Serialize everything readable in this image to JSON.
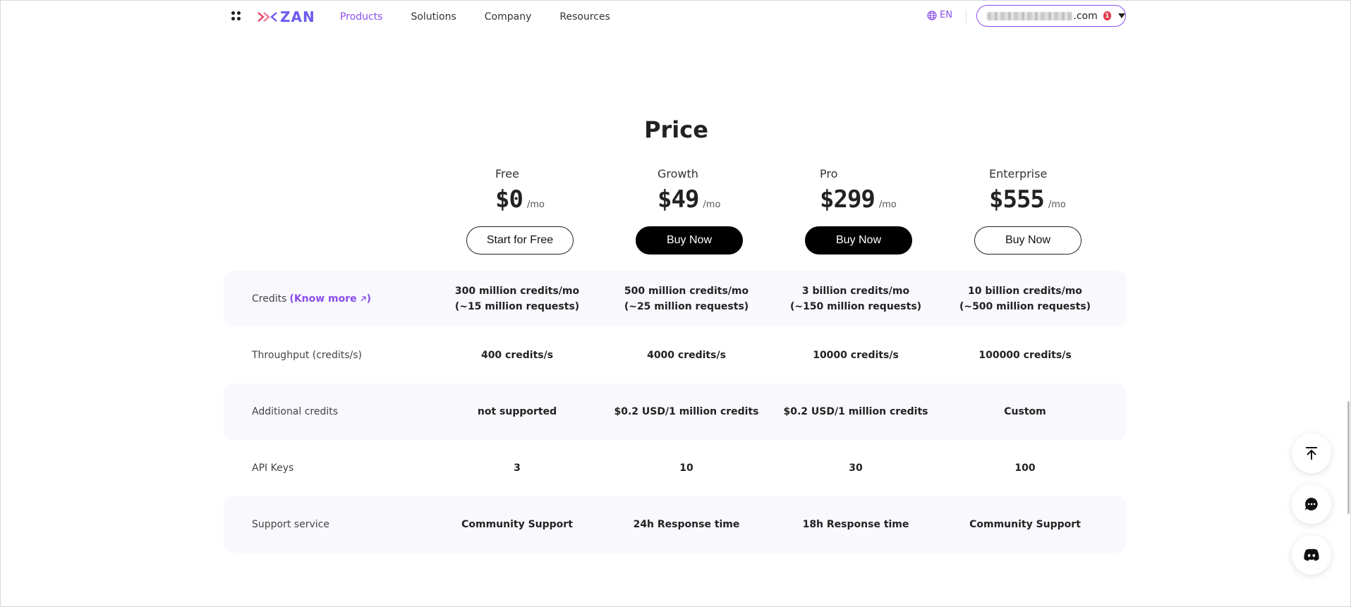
{
  "header": {
    "logo_text": "ZAN",
    "nav": [
      "Products",
      "Solutions",
      "Company",
      "Resources"
    ],
    "active_nav": "Products",
    "language": "EN",
    "account_email_suffix": ".com",
    "notification_count": "1",
    "icons": [
      "apps-grid-icon",
      "globe-icon",
      "chevron-down-icon"
    ]
  },
  "title": "Price",
  "plans": [
    {
      "name": "Free",
      "price": "$0",
      "unit": "/mo",
      "button": "Start for Free",
      "button_style": "outline"
    },
    {
      "name": "Growth",
      "price": "$49",
      "unit": "/mo",
      "button": "Buy Now",
      "button_style": "solid"
    },
    {
      "name": "Pro",
      "price": "$299",
      "unit": "/mo",
      "button": "Buy Now",
      "button_style": "solid"
    },
    {
      "name": "Enterprise",
      "price": "$555",
      "unit": "/mo",
      "button": "Buy Now",
      "button_style": "outline"
    }
  ],
  "table": {
    "know_more": "Know more",
    "rows": [
      {
        "label": "Credits",
        "values": [
          "300 million credits/mo\n(~15 million requests)",
          "500 million credits/mo\n(~25 million requests)",
          "3 billion credits/mo\n(~150 million requests)",
          "10 billion credits/mo\n(~500 million requests)"
        ]
      },
      {
        "label": "Throughput (credits/s)",
        "values": [
          "400 credits/s",
          "4000 credits/s",
          "10000 credits/s",
          "100000 credits/s"
        ]
      },
      {
        "label": "Additional credits",
        "values": [
          "not supported",
          "$0.2 USD/1 million credits",
          "$0.2 USD/1 million credits",
          "Custom"
        ]
      },
      {
        "label": "API Keys",
        "values": [
          "3",
          "10",
          "30",
          "100"
        ]
      },
      {
        "label": "Support service",
        "values": [
          "Community Support",
          "24h Response time",
          "18h Response time",
          "Community Support"
        ]
      }
    ]
  },
  "floating_buttons": [
    "back-to-top-icon",
    "chat-icon",
    "discord-icon"
  ],
  "colors": {
    "accent": "#8a4dec",
    "row_shade": "#f8f8fd",
    "logo": "#6d5bf0",
    "badge": "#e5384a"
  }
}
